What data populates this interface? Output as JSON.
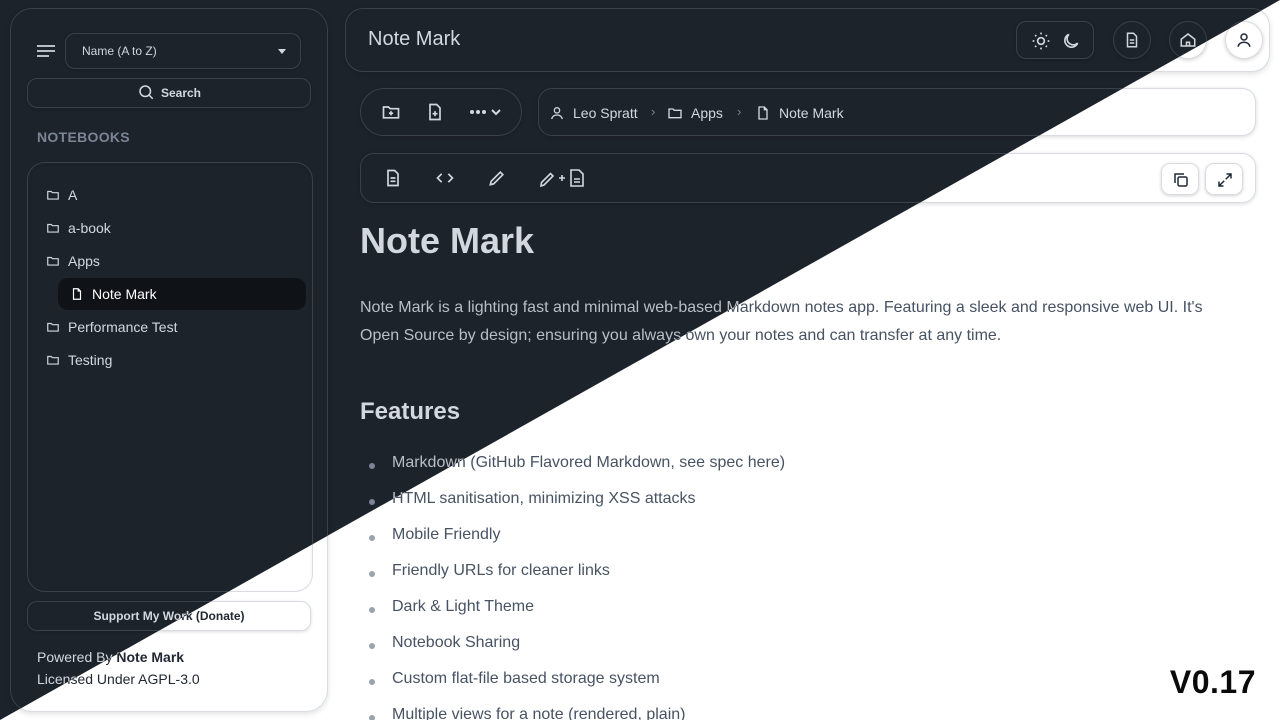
{
  "sidebar": {
    "sort_label": "Name (A to Z)",
    "search_label": "Search",
    "notebooks_heading": "NOTEBOOKS",
    "items": [
      {
        "label": "A",
        "icon": "folder-icon"
      },
      {
        "label": "a-book",
        "icon": "folder-icon"
      },
      {
        "label": "Apps",
        "icon": "folder-icon"
      },
      {
        "label": "Note Mark",
        "icon": "document-icon",
        "selected": true
      },
      {
        "label": "Performance Test",
        "icon": "folder-icon"
      },
      {
        "label": "Testing",
        "icon": "folder-icon"
      }
    ],
    "donate_label": "Support My Work (Donate)",
    "powered_prefix": "Powered By ",
    "powered_name": "Note Mark",
    "license": "Licensed Under AGPL-3.0"
  },
  "header": {
    "title": "Note Mark"
  },
  "breadcrumb": {
    "user": "Leo Spratt",
    "folder": "Apps",
    "note": "Note Mark"
  },
  "document": {
    "title": "Note Mark",
    "intro": "Note Mark is a lighting fast and minimal web-based Markdown notes app. Featuring a sleek and responsive web UI. It's Open Source by design; ensuring you always own your notes and can transfer at any time.",
    "features_heading": "Features",
    "features": [
      "Markdown (GitHub Flavored Markdown, see spec here)",
      "HTML sanitisation, minimizing XSS attacks",
      "Mobile Friendly",
      "Friendly URLs for cleaner links",
      "Dark & Light Theme",
      "Notebook Sharing",
      "Custom flat-file based storage system",
      "Multiple views for a note (rendered, plain)"
    ]
  },
  "version": "V0.17",
  "colors": {
    "dark_background": "#1d232b",
    "light_background": "#ffffff",
    "selected_dark": "#0f1318",
    "selected_light": "#e8eaee"
  }
}
